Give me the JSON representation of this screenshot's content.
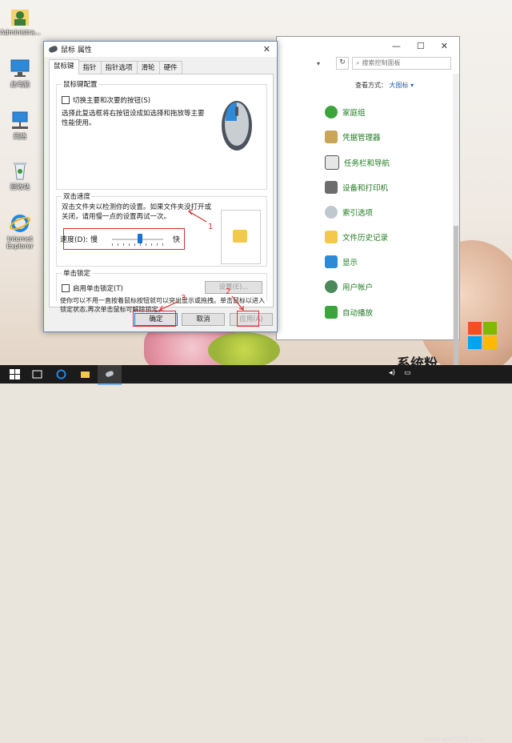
{
  "desktop": {
    "icons": [
      {
        "label": "Administra..."
      },
      {
        "label": "此电脑"
      },
      {
        "label": "网络"
      },
      {
        "label": "回收站"
      },
      {
        "label": "Internet Explorer"
      }
    ]
  },
  "control_panel": {
    "search_placeholder": "搜索控制面板",
    "view_by_label": "查看方式：",
    "view_by_value": "大图标",
    "items": [
      "家庭组",
      "凭据管理器",
      "任务栏和导航",
      "设备和打印机",
      "索引选项",
      "文件历史记录",
      "显示",
      "用户帐户",
      "自动播放"
    ]
  },
  "dialog": {
    "title": "鼠标 属性",
    "tabs": [
      "鼠标键",
      "指针",
      "指针选项",
      "滑轮",
      "硬件"
    ],
    "active_tab": "鼠标键",
    "buttons_config": {
      "group_title": "鼠标键配置",
      "checkbox_label": "切换主要和次要的按钮(S)",
      "checked": false,
      "description": "选择此复选框将右按钮设成如选择和拖放等主要性能使用。"
    },
    "double_click": {
      "group_title": "双击速度",
      "description": "双击文件夹以检测你的设置。如果文件夹没打开或关闭，请用慢一点的设置再试一次。",
      "speed_label": "速度(D):",
      "slow_label": "慢",
      "fast_label": "快",
      "speed_level": 0.55
    },
    "click_lock": {
      "group_title": "单击锁定",
      "checkbox_label": "启用单击锁定(T)",
      "checked": false,
      "settings_button": "设置(E)...",
      "description": "使你可以不用一直按着鼠标按钮就可以突出显示或拖拽。单击鼠标以进入锁定状态,再次单击鼠标可解除锁定。"
    },
    "ok_label": "确定",
    "cancel_label": "取消",
    "apply_label": "应用(A)"
  },
  "annotations": [
    "1",
    "2",
    "3"
  ],
  "watermark": {
    "text": "系统粉",
    "url": "www.win7999.com"
  },
  "colors": {
    "accent": "#1a73d2",
    "annotation_red": "#d83030",
    "cp_link_green": "#1e7a20"
  }
}
